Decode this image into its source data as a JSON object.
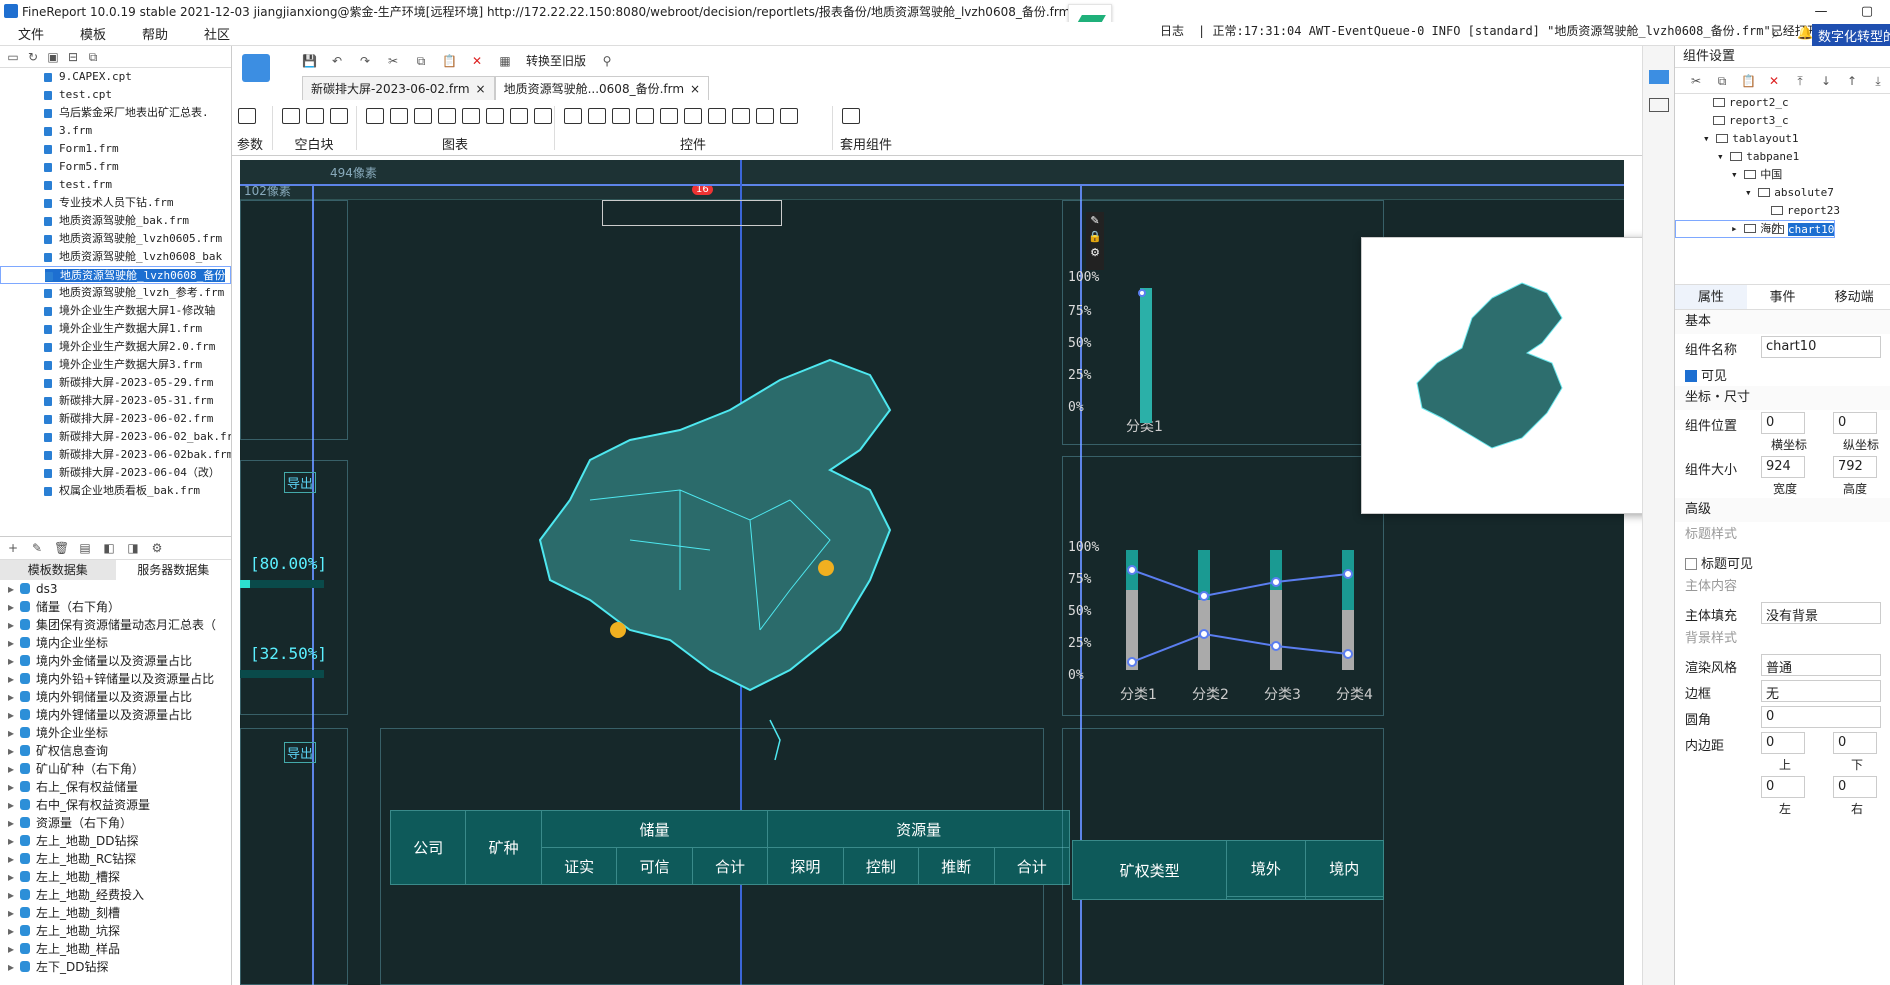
{
  "window": {
    "title": "FineReport 10.0.19 stable 2021-12-03 jiangjianxiong@紫金-生产环境[远程环境]    http://172.22.22.150:8080/webroot/decision/reportlets/报表备份/地质资源驾驶舱_lvzh0608_备份.frm"
  },
  "menu": [
    "文件",
    "模板",
    "帮助",
    "社区"
  ],
  "log": {
    "label": "日志",
    "text": "| 正常:17:31:04 AWT-EventQueue-0 INFO [standard] \"地质资源驾驶舱_lvzh0608_备份.frm\"已经打开!",
    "button": "数字化转型的"
  },
  "files": [
    "9.CAPEX.cpt",
    "test.cpt",
    "乌后紫金采厂地表出矿汇总表.",
    "3.frm",
    "Form1.frm",
    "Form5.frm",
    "test.frm",
    "专业技术人员下钻.frm",
    "地质资源驾驶舱_bak.frm",
    "地质资源驾驶舱_lvzh0605.frm",
    "地质资源驾驶舱_lvzh0608_bak",
    "地质资源驾驶舱_lvzh0608_备份",
    "地质资源驾驶舱_lvzh_参考.frm",
    "境外企业生产数据大屏1-修改轴",
    "境外企业生产数据大屏1.frm",
    "境外企业生产数据大屏2.0.frm",
    "境外企业生产数据大屏3.frm",
    "新碳排大屏-2023-05-29.frm",
    "新碳排大屏-2023-05-31.frm",
    "新碳排大屏-2023-06-02.frm",
    "新碳排大屏-2023-06-02_bak.frm",
    "新碳排大屏-2023-06-02bak.frm",
    "新碳排大屏-2023-06-04（改）",
    "权属企业地质看板_bak.frm"
  ],
  "ds_tabs": [
    "模板数据集",
    "服务器数据集"
  ],
  "datasets": [
    "ds3",
    "储量（右下角）",
    "集团保有资源储量动态月汇总表（",
    "境内企业坐标",
    "境内外金储量以及资源量占比",
    "境内外铅+锌储量以及资源量占比",
    "境内外铜储量以及资源量占比",
    "境内外锂储量以及资源量占比",
    "境外企业坐标",
    "矿权信息查询",
    "矿山矿种（右下角）",
    "右上_保有权益储量",
    "右中_保有权益资源量",
    "资源量（右下角）",
    "左上_地勘_DD钻探",
    "左上_地勘_RC钻探",
    "左上_地勘_槽探",
    "左上_地勘_经费投入",
    "左上_地勘_刻槽",
    "左上_地勘_坑探",
    "左上_地勘_样品",
    "左下_DD钻探"
  ],
  "tabs": [
    "新碳排大屏-2023-06-02.frm",
    "地质资源驾驶舱...0608_备份.frm"
  ],
  "toolbar": {
    "compat": "转换至旧版"
  },
  "ribbon": {
    "params": "参数",
    "blank": "空白块",
    "charts": "图表",
    "controls": "控件",
    "templates": "套用组件"
  },
  "canvas": {
    "ruler_note": "494像素",
    "ruler_left": "102像素",
    "badge": "16",
    "export": "导出",
    "export2": "导出",
    "pct1": "[80.00%]",
    "pct2": "[32.50%]",
    "yticks": [
      "100%",
      "75%",
      "50%",
      "25%",
      "0%"
    ],
    "categories": [
      "分类1",
      "分类2",
      "分类3",
      "分类4"
    ],
    "top_cat": "分类1"
  },
  "table": {
    "h_company": "公司",
    "h_mineral": "矿种",
    "h_reserve": "储量",
    "h_resource": "资源量",
    "sub": [
      "证实",
      "可信",
      "合计",
      "探明",
      "控制",
      "推断",
      "合计"
    ]
  },
  "table2": {
    "h1": "矿权类型",
    "h2": "境外",
    "h3": "境内"
  },
  "rpanel": {
    "title": "组件设置",
    "tree": [
      "report2_c",
      "report3_c",
      "tablayout1",
      "tabpane1",
      "中国",
      "absolute7",
      "report23",
      "chart10",
      "海外"
    ],
    "ptabs": [
      "属性",
      "事件",
      "移动端"
    ],
    "basic": "基本",
    "name_label": "组件名称",
    "name_value": "chart10",
    "visible": "可见",
    "coord": "坐标・尺寸",
    "pos_label": "组件位置",
    "pos_x": "0",
    "pos_y": "0",
    "x_label": "横坐标",
    "y_label": "纵坐标",
    "size_label": "组件大小",
    "width": "924",
    "height": "792",
    "w_label": "宽度",
    "h_label": "高度",
    "advanced": "高级",
    "title_style": "标题样式",
    "title_visible": "标题可见",
    "body": "主体内容",
    "body_fill": "主体填充",
    "body_fill_value": "没有背景",
    "bg_style": "背景样式",
    "render": "渲染风格",
    "render_value": "普通",
    "border": "边框",
    "border_value": "无",
    "radius": "圆角",
    "radius_value": "0",
    "padding": "内边距",
    "pad_top": "0",
    "pad_bottom": "0",
    "pad_left": "0",
    "pad_right": "0",
    "top": "上",
    "bottom": "下",
    "left": "左",
    "right": "右"
  }
}
